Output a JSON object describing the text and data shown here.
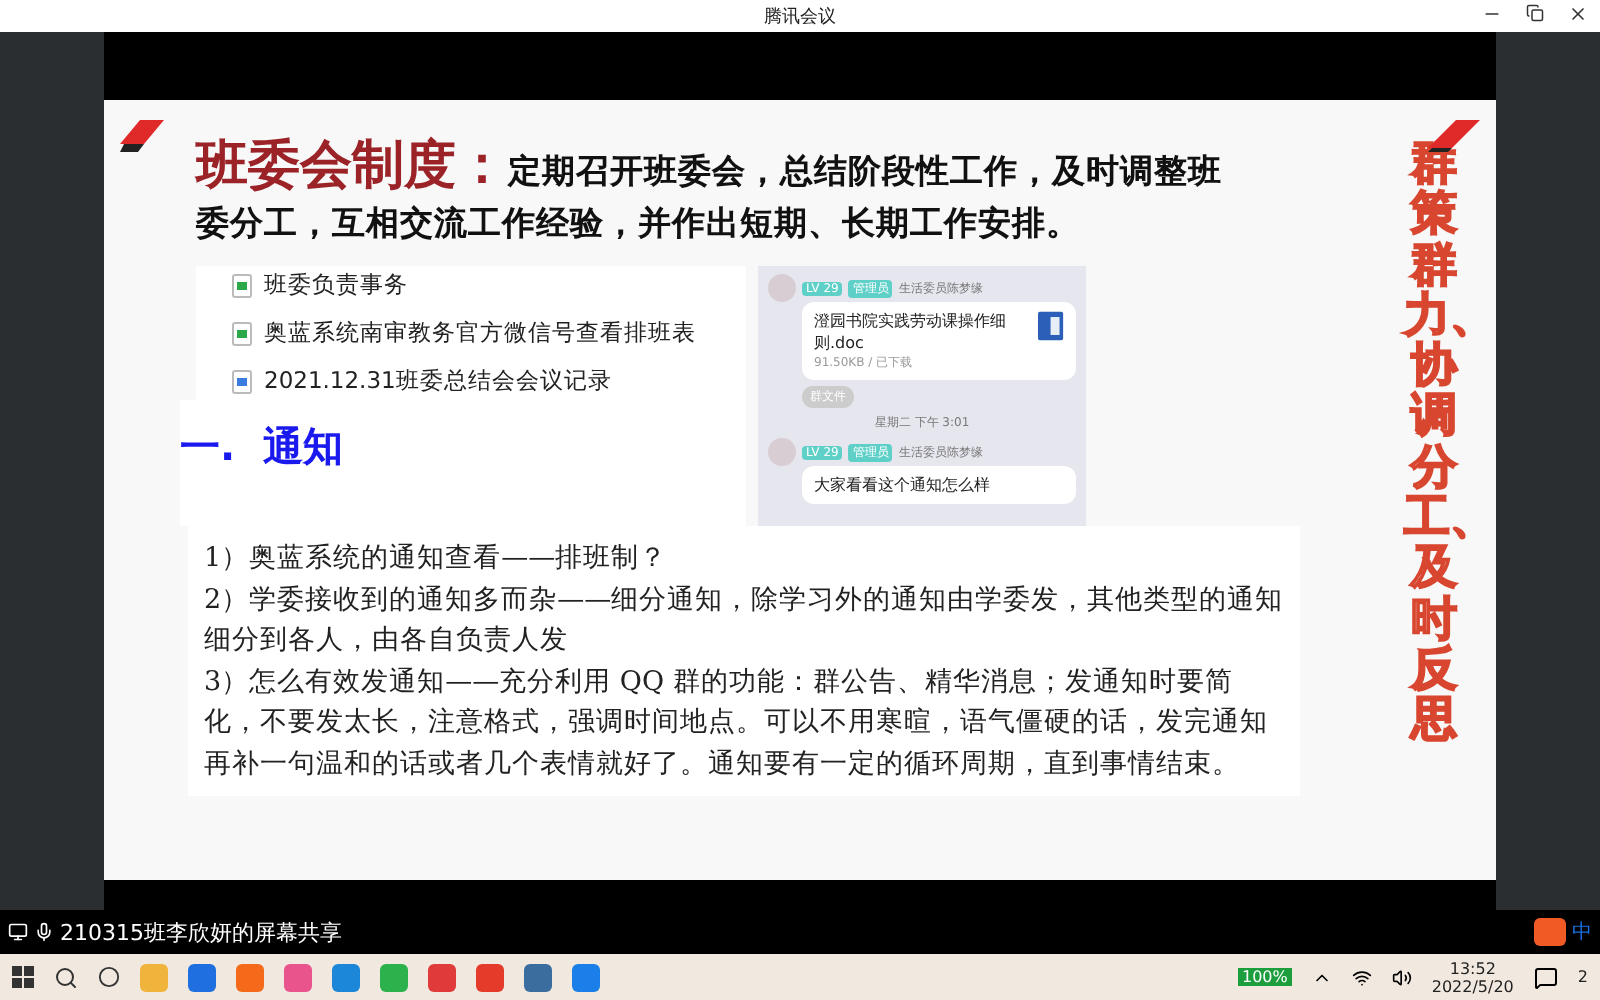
{
  "window": {
    "title": "腾讯会议"
  },
  "slide": {
    "heading": "班委会制度：",
    "heading_body": "定期召开班委会，总结阶段性工作，及时调整班委分工，互相交流工作经验，并作出短期、长期工作安排。",
    "docs": [
      {
        "name": "班委负责事务",
        "kind": "sheet"
      },
      {
        "name": "奥蓝系统南审教务官方微信号查看排班表",
        "kind": "sheet"
      },
      {
        "name": "2021.12.31班委总结会会议记录",
        "kind": "doc"
      }
    ],
    "chat": [
      {
        "kind": "file",
        "level": "LV 29",
        "role": "管理员",
        "sender": "生活委员陈梦缘",
        "file_name": "澄园书院实践劳动课操作细则.doc",
        "file_meta": "91.50KB / 已下载"
      },
      {
        "kind": "chip",
        "text": "群文件"
      },
      {
        "kind": "time",
        "text": "星期二 下午 3:01"
      },
      {
        "kind": "text",
        "level": "LV 29",
        "role": "管理员",
        "sender": "生活委员陈梦缘",
        "text": "大家看看这个通知怎么样"
      }
    ],
    "section_title": "一.  通知",
    "notes": [
      "1）奥蓝系统的通知查看——排班制？",
      "2）学委接收到的通知多而杂——细分通知，除学习外的通知由学委发，其他类型的通知细分到各人，由各自负责人发",
      "3）怎么有效发通知——充分利用 QQ 群的功能：群公告、精华消息；发通知时要简化，不要发太长，注意格式，强调时间地点。可以不用寒暄，语气僵硬的话，发完通知再补一句温和的话或者几个表情就好了。通知要有一定的循环周期，直到事情结束。"
    ],
    "side_slogan": "群策群力、协调分工、及时反思"
  },
  "share_bar": {
    "label": "210315班李欣妍的屏幕共享",
    "ime": "中"
  },
  "taskbar": {
    "battery": "100%",
    "time": "13:52",
    "date": "2022/5/20",
    "notifications": "2"
  }
}
